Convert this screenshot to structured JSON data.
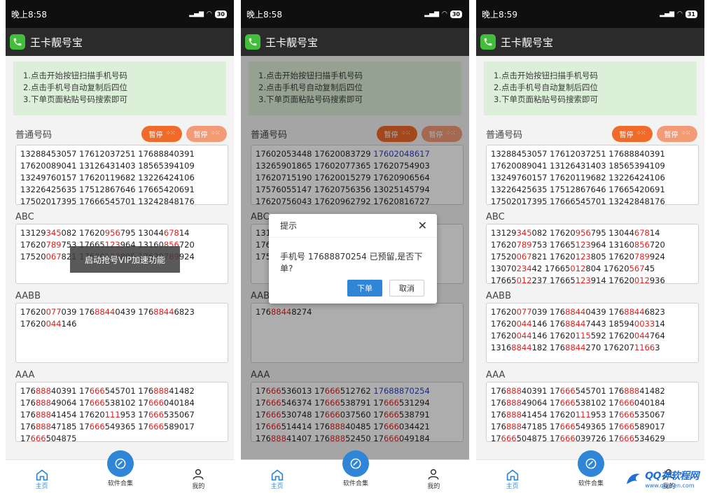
{
  "screens": [
    {
      "time": "晚上8:58",
      "signal": "⁵ᴳıll",
      "battery": "30",
      "title": "王卡靓号宝",
      "instructions": [
        "1.点击开始按钮扫描手机号码",
        "2.点击手机号自动复制后四位",
        "3.下单页面粘贴号码搜索即可"
      ],
      "section_title": "普通号码",
      "pause1": "暂停",
      "pause2": "暂停",
      "label_abc": "ABC",
      "label_aabb": "AABB",
      "label_aaa": "AAA",
      "toast": "启动抢号VIP加速功能",
      "nav_home": "主页",
      "nav_center": "软件合集",
      "nav_me": "我的"
    },
    {
      "time": "晚上8:58",
      "signal": "⁵ᴳıll",
      "battery": "30",
      "title": "王卡靓号宝",
      "instructions": [
        "1.点击开始按钮扫描手机号码",
        "2.点击手机号自动复制后四位",
        "3.下单页面粘贴号码搜索即可"
      ],
      "section_title": "普通号码",
      "pause1": "暂停",
      "pause2": "暂停",
      "label_abc": "ABC",
      "label_aabb": "AABB",
      "label_aaa": "AAA",
      "dialog_title": "提示",
      "dialog_msg": "手机号 17688870254 已预留,是否下单?",
      "dialog_ok": "下单",
      "dialog_cancel": "取消",
      "nav_home": "主页",
      "nav_center": "软件合集",
      "nav_me": "我的"
    },
    {
      "time": "晚上8:59",
      "signal": "⁵ᴳıll",
      "battery": "31",
      "title": "王卡靓号宝",
      "instructions": [
        "1.点击开始按钮扫描手机号码",
        "2.点击手机号自动复制后四位",
        "3.下单页面粘贴号码搜索即可"
      ],
      "section_title": "普通号码",
      "pause1": "暂停",
      "pause2": "暂停",
      "label_abc": "ABC",
      "label_aabb": "AABB",
      "label_aaa": "AAA",
      "nav_home": "主页",
      "nav_center": "软件合集",
      "nav_me": "我的"
    }
  ],
  "normal_rows_a": [
    "13288453057 17612037251 17688840391",
    "17620089041 13126431403 18565394109",
    "13249760157 17620119682 13226424106",
    "13226425635 17512867646 17665420691",
    "17502017395 17666545701 13242848176"
  ],
  "normal_rows_b": [
    "17602053448 17620083729 ",
    "13265901865 17602077365 17620754903",
    "17620715190 17620015279 17620906564",
    "17576055147 17620756356 13025145794",
    "17620756043 17620962792 17620816727"
  ],
  "normal_rows_b_blue": "17602048617",
  "abc_rows_a": [
    [
      "13129",
      "345",
      "082 17620",
      "956",
      "795 13044",
      "678",
      "14"
    ],
    [
      "17620",
      "789",
      "753 17665",
      "123",
      "964 13160",
      "856",
      "720"
    ],
    [
      "17520",
      "067",
      "821 17620",
      "123",
      "805 17620",
      "789",
      "924"
    ]
  ],
  "abc_rows_c": [
    [
      "13129",
      "345",
      "082 17620",
      "956",
      "795 13044",
      "678",
      "14"
    ],
    [
      "17620",
      "789",
      "753 17665",
      "123",
      "964 13160",
      "856",
      "720"
    ],
    [
      "17520",
      "067",
      "821 17620",
      "123",
      "805 17620",
      "789",
      "924"
    ],
    [
      "13070",
      "234",
      "42 17665",
      "012",
      "804 17620",
      "567",
      "45"
    ],
    [
      "17665",
      "012",
      "237 17665",
      "123",
      "914 17620",
      "012",
      "936"
    ]
  ],
  "aabb_rows_a": [
    [
      "17620",
      "077",
      "039 176",
      "8844",
      "0439 176",
      "8844",
      "6823"
    ],
    [
      "17620",
      "044",
      "146",
      "",
      "",
      "",
      ""
    ]
  ],
  "aabb_rows_b": [
    [
      "176",
      "8844",
      "8274",
      "",
      "",
      "",
      ""
    ]
  ],
  "aabb_rows_c": [
    [
      "17620",
      "077",
      "039 176",
      "8844",
      "0439 176",
      "8844",
      "6823"
    ],
    [
      "17620",
      "044",
      "146 176",
      "8844",
      "7443 18594",
      "0033",
      "14"
    ],
    [
      "17620",
      "044",
      "146 17620",
      "115",
      "592 17620",
      "044",
      "764"
    ],
    [
      "1316",
      "8844",
      "182 176",
      "8844",
      "270 176207",
      "1166",
      "3"
    ]
  ],
  "aaa_rows_a": [
    [
      "176",
      "888",
      "40391 17",
      "666",
      "545701 176",
      "888",
      "41482"
    ],
    [
      "176",
      "888",
      "49064 17",
      "666",
      "538102 17",
      "666",
      "040184"
    ],
    [
      "176",
      "888",
      "41454 17620",
      "111",
      "953 17",
      "666",
      "535067"
    ],
    [
      "176",
      "888",
      "47185 17",
      "666",
      "549365 17",
      "666",
      "589017"
    ],
    [
      "17",
      "666",
      "504875",
      "",
      "",
      "",
      ""
    ]
  ],
  "aaa_rows_b": [
    [
      "17",
      "666",
      "536013 17",
      "666",
      "512762 ",
      "",
      ""
    ],
    [
      "17",
      "666",
      "546374 17",
      "666",
      "538791 17",
      "666",
      "531294"
    ],
    [
      "17",
      "666",
      "530748 17",
      "666",
      "037560 17",
      "666",
      "538791"
    ],
    [
      "17",
      "666",
      "514414 176",
      "888",
      "40485 17",
      "666",
      "034421"
    ],
    [
      "176",
      "888",
      "41407 176",
      "888",
      "52450 17",
      "666",
      "049184"
    ]
  ],
  "aaa_b_blue": "17688870254",
  "aaa_rows_c": [
    [
      "176",
      "888",
      "40391 17",
      "666",
      "545701 176",
      "888",
      "41482"
    ],
    [
      "176",
      "888",
      "49064 17",
      "666",
      "538102 17",
      "666",
      "040184"
    ],
    [
      "176",
      "888",
      "41454 17620",
      "111",
      "953 17",
      "666",
      "535067"
    ],
    [
      "176",
      "888",
      "47185 17",
      "666",
      "549365 17",
      "666",
      "589017"
    ],
    [
      "17",
      "666",
      "504875 17",
      "666",
      "039726 17",
      "666",
      "534629"
    ]
  ],
  "watermark": {
    "main": "QQ神软程网",
    "sub": "www.qqshen.com"
  },
  "colors": {
    "accent": "#2f86d6",
    "highlight_red": "#e02020",
    "highlight_blue": "#2a3fc8",
    "pause": "#f06a2a",
    "instr_bg": "#dcefd8"
  }
}
